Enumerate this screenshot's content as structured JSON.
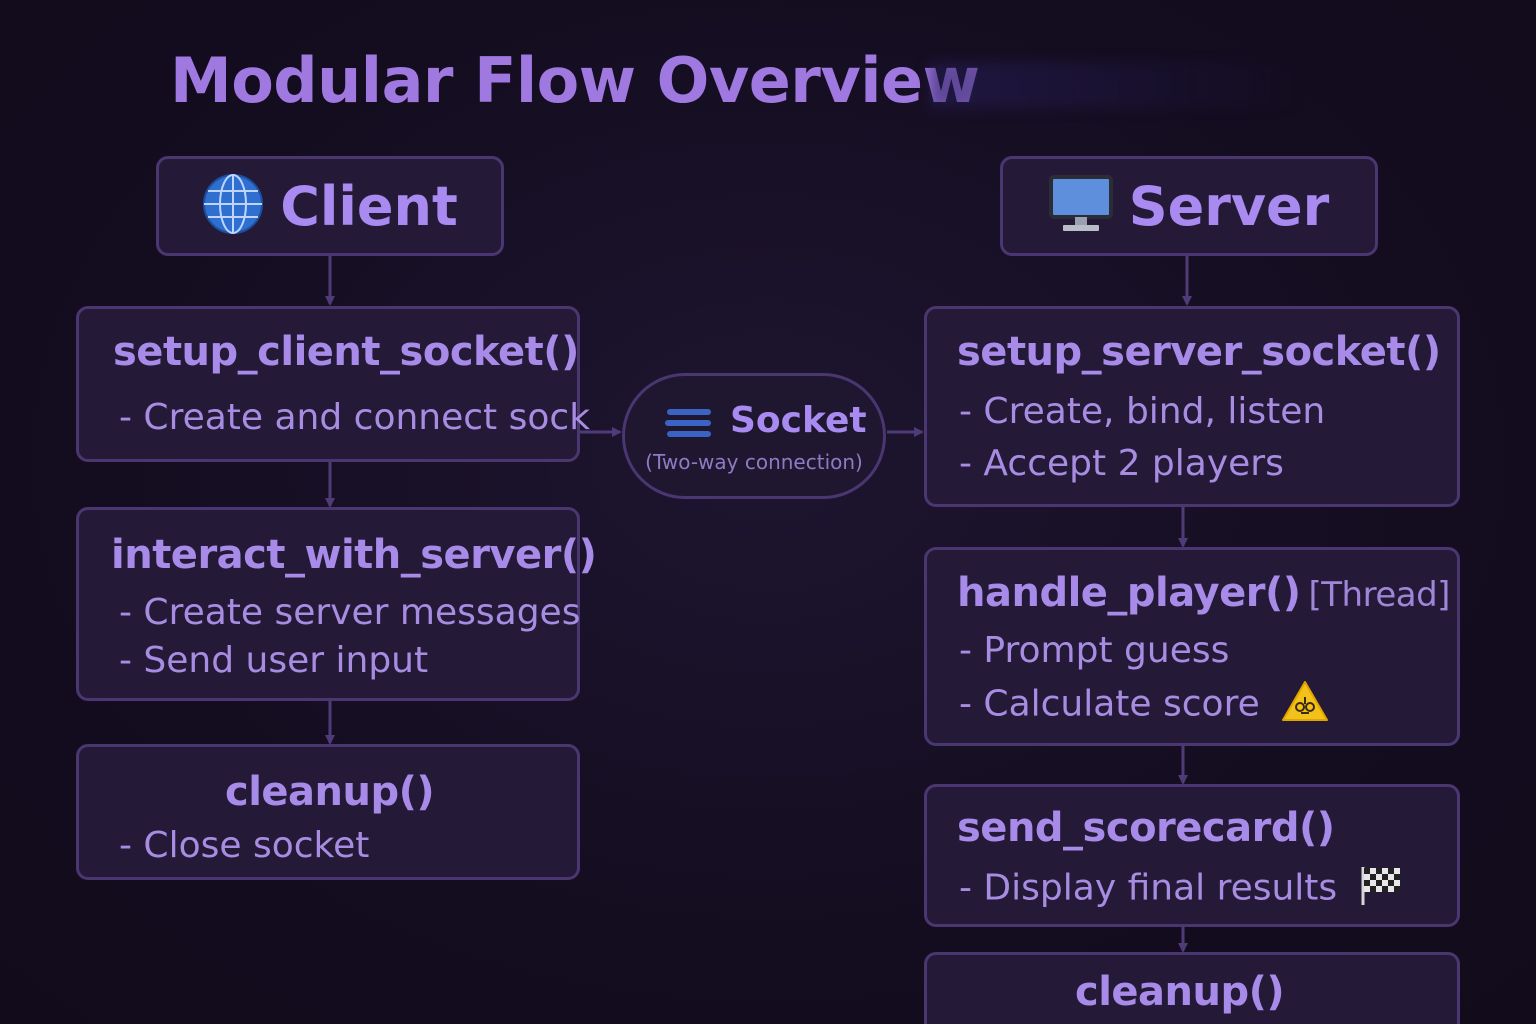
{
  "title": "Modular Flow Overview",
  "client": {
    "header": "Client",
    "header_icon": "globe-icon",
    "steps": [
      {
        "function": "setup_client_socket()",
        "lines": [
          "- Create and connect sock"
        ]
      },
      {
        "function": "interact_with_server()",
        "lines": [
          "- Create server messages",
          "- Send user input"
        ]
      },
      {
        "function": "cleanup()",
        "lines": [
          "- Close socket"
        ]
      }
    ]
  },
  "socket": {
    "label": "Socket",
    "sublabel": "(Two-way connection)",
    "icon": "stack-lines-icon"
  },
  "server": {
    "header": "Server",
    "header_icon": "monitor-icon",
    "steps": [
      {
        "function": "setup_server_socket()",
        "lines": [
          "- Create, bind, listen",
          "- Accept 2 players"
        ]
      },
      {
        "function": "handle_player()",
        "tag": "[Thread]",
        "lines": [
          "- Prompt guess",
          "- Calculate score"
        ],
        "line_icons": [
          "",
          "warning-icon"
        ]
      },
      {
        "function": "send_scorecard()",
        "lines": [
          "- Display final results"
        ],
        "line_icons": [
          "checkered-flag-icon"
        ]
      },
      {
        "function": "cleanup()",
        "lines": []
      }
    ]
  },
  "colors": {
    "background": "#150e22",
    "box_fill": "#241a38",
    "box_border": "#4a3670",
    "text": "#a88af0",
    "connector": "#4f3b78"
  }
}
